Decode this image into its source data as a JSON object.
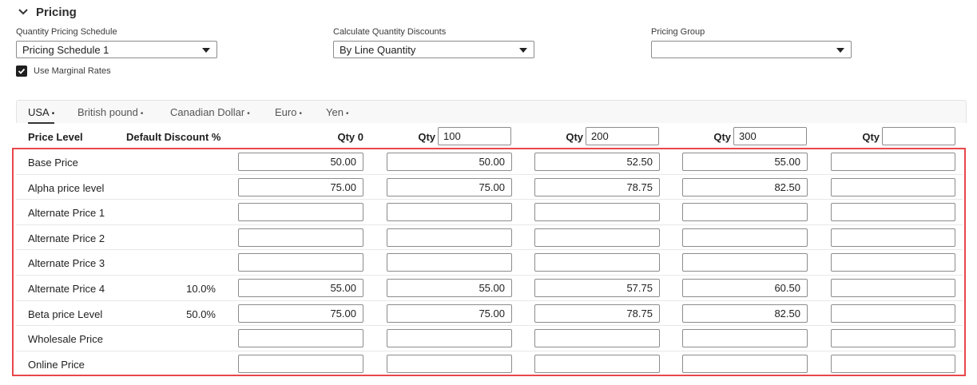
{
  "section": {
    "title": "Pricing"
  },
  "fields": {
    "quantity_pricing_schedule": {
      "label": "Quantity Pricing Schedule",
      "value": "Pricing Schedule 1"
    },
    "calculate_quantity_discounts": {
      "label": "Calculate Quantity Discounts",
      "value": "By Line Quantity"
    },
    "pricing_group": {
      "label": "Pricing Group",
      "value": ""
    }
  },
  "use_marginal_rates": {
    "label": "Use Marginal Rates",
    "checked": true
  },
  "tabs": [
    {
      "label": "USA",
      "active": true
    },
    {
      "label": "British pound",
      "active": false
    },
    {
      "label": "Canadian Dollar",
      "active": false
    },
    {
      "label": "Euro",
      "active": false
    },
    {
      "label": "Yen",
      "active": false
    }
  ],
  "tab_dot": "•",
  "columns": {
    "price_level": "Price Level",
    "default_discount": "Default Discount %",
    "qty_label": "Qty",
    "qty0": "Qty 0",
    "qty_values": [
      "100",
      "200",
      "300",
      ""
    ]
  },
  "rows": [
    {
      "label": "Base Price",
      "discount": "",
      "values": [
        "50.00",
        "50.00",
        "52.50",
        "55.00",
        ""
      ]
    },
    {
      "label": "Alpha price level",
      "discount": "",
      "values": [
        "75.00",
        "75.00",
        "78.75",
        "82.50",
        ""
      ]
    },
    {
      "label": "Alternate Price 1",
      "discount": "",
      "values": [
        "",
        "",
        "",
        "",
        ""
      ]
    },
    {
      "label": "Alternate Price 2",
      "discount": "",
      "values": [
        "",
        "",
        "",
        "",
        ""
      ]
    },
    {
      "label": "Alternate Price 3",
      "discount": "",
      "values": [
        "",
        "",
        "",
        "",
        ""
      ]
    },
    {
      "label": "Alternate Price 4",
      "discount": "10.0%",
      "values": [
        "55.00",
        "55.00",
        "57.75",
        "60.50",
        ""
      ]
    },
    {
      "label": "Beta price Level",
      "discount": "50.0%",
      "values": [
        "75.00",
        "75.00",
        "78.75",
        "82.50",
        ""
      ]
    },
    {
      "label": "Wholesale Price",
      "discount": "",
      "values": [
        "",
        "",
        "",
        "",
        ""
      ]
    },
    {
      "label": "Online Price",
      "discount": "",
      "values": [
        "",
        "",
        "",
        "",
        ""
      ]
    }
  ],
  "colors": {
    "highlight_border": "#e8474c",
    "input_border": "#8c8c8c"
  }
}
